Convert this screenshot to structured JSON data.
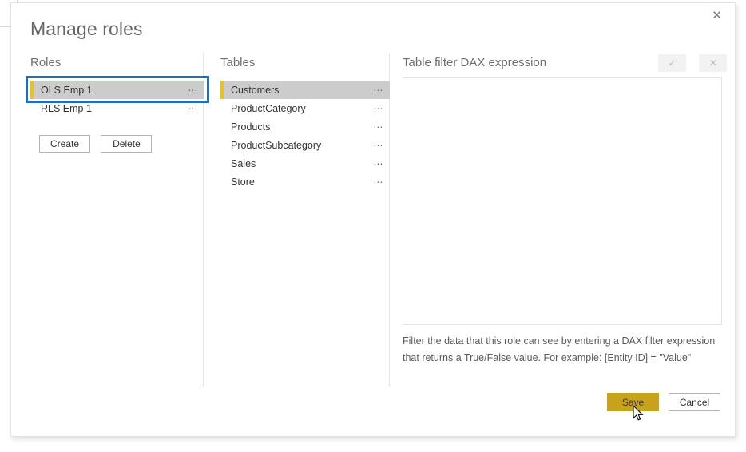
{
  "dialog": {
    "title": "Manage roles",
    "close_label": "✕",
    "close_icon": "close-icon"
  },
  "roles_panel": {
    "heading": "Roles",
    "items": [
      {
        "label": "OLS Emp 1",
        "selected": true,
        "menu": "⋯"
      },
      {
        "label": "RLS Emp 1",
        "selected": false,
        "menu": "⋯"
      }
    ],
    "create_label": "Create",
    "delete_label": "Delete"
  },
  "tables_panel": {
    "heading": "Tables",
    "items": [
      {
        "label": "Customers",
        "selected": true,
        "menu": "⋯"
      },
      {
        "label": "ProductCategory",
        "selected": false,
        "menu": "⋯"
      },
      {
        "label": "Products",
        "selected": false,
        "menu": "⋯"
      },
      {
        "label": "ProductSubcategory",
        "selected": false,
        "menu": "⋯"
      },
      {
        "label": "Sales",
        "selected": false,
        "menu": "⋯"
      },
      {
        "label": "Store",
        "selected": false,
        "menu": "⋯"
      }
    ]
  },
  "dax_panel": {
    "heading": "Table filter DAX expression",
    "accept_label": "✓",
    "accept_icon": "check-icon",
    "reject_label": "✕",
    "reject_icon": "close-small-icon",
    "expression_value": "",
    "expression_placeholder": "",
    "hint_line_1": "Filter the data that this role can see by entering a DAX filter expression",
    "hint_line_2": "that returns a True/False value. For example: [Entity ID] = \"Value\""
  },
  "footer": {
    "save_label": "Save",
    "cancel_label": "Cancel"
  },
  "colors": {
    "accent_gold": "#e8c220",
    "save_button": "#c9a21c",
    "focus_blue": "#1f6ec1",
    "row_selected": "#cccccc",
    "title_text": "#666666"
  }
}
